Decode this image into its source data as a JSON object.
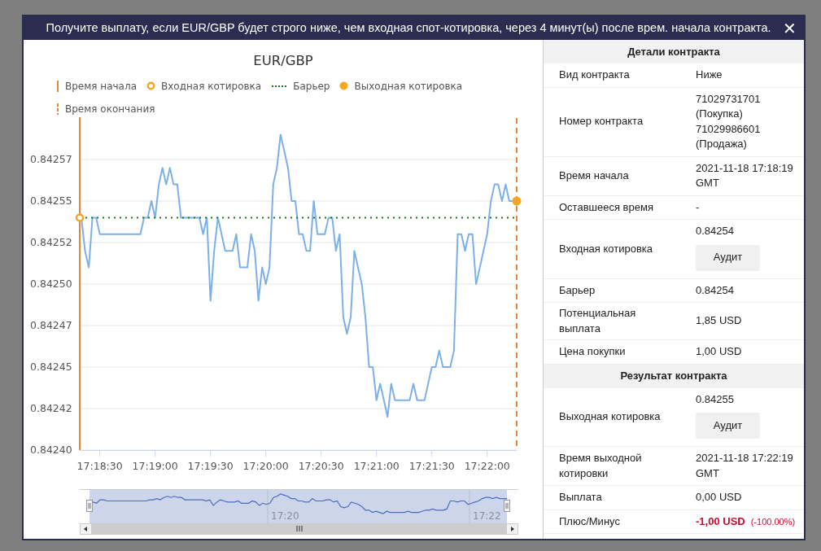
{
  "modal": {
    "title": "Получите выплату, если EUR/GBP будет строго ниже, чем входная спот-котировка, через 4 минут(ы) после врем. начала контракта.",
    "close": "✕"
  },
  "chart": {
    "legend": [
      {
        "kind": "start_line",
        "label": "Время начала"
      },
      {
        "kind": "entry",
        "label": "Входная котировка"
      },
      {
        "kind": "barrier",
        "label": "Барьер"
      },
      {
        "kind": "exit",
        "label": "Выходная котировка"
      },
      {
        "kind": "end_line",
        "label": "Время окончания"
      }
    ],
    "chart_data": {
      "type": "line",
      "title": "EUR/GBP",
      "categories": [
        null,
        null,
        null,
        null,
        null,
        "17:18:30",
        null,
        null,
        null,
        null,
        null,
        null,
        null,
        null,
        null,
        null,
        null,
        null,
        null,
        null,
        "17:19:00",
        null,
        null,
        null,
        null,
        null,
        null,
        null,
        null,
        null,
        null,
        null,
        null,
        null,
        null,
        "17:19:30",
        null,
        null,
        null,
        null,
        null,
        null,
        null,
        null,
        null,
        null,
        null,
        null,
        null,
        null,
        "17:20:00",
        null,
        null,
        null,
        null,
        null,
        null,
        null,
        null,
        null,
        null,
        null,
        null,
        null,
        null,
        "17:20:30",
        null,
        null,
        null,
        null,
        null,
        null,
        null,
        null,
        null,
        null,
        null,
        null,
        null,
        null,
        "17:21:00",
        null,
        null,
        null,
        null,
        null,
        null,
        null,
        null,
        null,
        null,
        null,
        null,
        null,
        null,
        "17:21:30",
        null,
        null,
        null,
        null,
        null,
        null,
        null,
        null,
        null,
        null,
        null,
        null,
        null,
        null,
        "17:22:00",
        null,
        null,
        null,
        null,
        null,
        null,
        null,
        null
      ],
      "series": [
        {
          "color": "#7cb0e8",
          "values": [
            0.84254,
            0.84252,
            0.84251,
            0.84254,
            0.84254,
            0.84253,
            0.84253,
            0.84253,
            0.84253,
            0.84253,
            0.84253,
            0.84253,
            0.84253,
            0.84253,
            0.84253,
            0.84253,
            0.84253,
            0.84254,
            0.84254,
            0.84255,
            0.84254,
            0.84256,
            0.84257,
            0.84256,
            0.84257,
            0.84256,
            0.84256,
            0.84254,
            0.84254,
            0.84254,
            0.84254,
            0.84254,
            0.84254,
            0.84253,
            0.84254,
            0.84249,
            0.84252,
            0.84254,
            0.84253,
            0.84252,
            0.84252,
            0.84252,
            0.84253,
            0.84251,
            0.84251,
            0.84251,
            0.84253,
            0.84252,
            0.84249,
            0.84251,
            0.8425,
            0.84251,
            0.84256,
            0.84257,
            0.84259,
            0.84258,
            0.84257,
            0.84255,
            0.84255,
            0.84253,
            0.84253,
            0.84252,
            0.84252,
            0.84255,
            0.84253,
            0.84253,
            0.84253,
            0.84254,
            0.84254,
            0.84252,
            0.84253,
            0.84248,
            0.84247,
            0.84248,
            0.84252,
            0.84251,
            0.8425,
            0.84248,
            0.84245,
            0.84245,
            0.84243,
            0.84244,
            0.84243,
            0.84242,
            0.84244,
            0.84243,
            0.84243,
            0.84243,
            0.84243,
            0.84243,
            0.84244,
            0.84243,
            0.84243,
            0.84243,
            0.84244,
            0.84245,
            0.84245,
            0.84246,
            0.84245,
            0.84245,
            0.84245,
            0.84246,
            0.84253,
            0.84253,
            0.84252,
            0.84253,
            0.84253,
            0.8425,
            0.84251,
            0.84252,
            0.84253,
            0.84255,
            0.84256,
            0.84256,
            0.84255,
            0.84256,
            0.84255,
            0.84255,
            0.84255
          ]
        }
      ],
      "ylim": [
        0.8424,
        0.8426
      ],
      "grid": true,
      "ref_lines": [
        {
          "axis": "y",
          "value": 0.84254,
          "color": "#1a7a1a"
        }
      ],
      "yticks": [
        {
          "value": 0.8424,
          "label": "0.84240"
        },
        {
          "value": 0.842425,
          "label": "0.84242"
        },
        {
          "value": 0.84245,
          "label": "0.84245"
        },
        {
          "value": 0.842475,
          "label": "0.84247"
        },
        {
          "value": 0.8425,
          "label": "0.84250"
        },
        {
          "value": 0.842525,
          "label": "0.84252"
        },
        {
          "value": 0.84255,
          "label": "0.84255"
        },
        {
          "value": 0.842575,
          "label": "0.84257"
        }
      ]
    },
    "navigator": {
      "labels": [
        "17:20",
        "17:22"
      ]
    }
  },
  "sections": [
    {
      "title": "Детали контракта",
      "rows": [
        {
          "kind": "plain",
          "label": "Вид контракта",
          "value": [
            "Ниже"
          ]
        },
        {
          "kind": "plain",
          "label": "Номер контракта",
          "value": [
            "71029731701",
            "(Покупка)",
            "71029986601",
            "(Продажа)"
          ]
        },
        {
          "kind": "plain",
          "label": "Время начала",
          "value": [
            "2021-11-18 17:18:19",
            "GMT"
          ]
        },
        {
          "kind": "plain",
          "label": "Оставшееся время",
          "value": [
            "-"
          ]
        },
        {
          "kind": "audit",
          "label": "Входная котировка",
          "value": [
            "0.84254"
          ],
          "button": "Аудит"
        },
        {
          "kind": "plain",
          "label": "Барьер",
          "value": [
            "0.84254"
          ]
        },
        {
          "kind": "plain",
          "label": "Потенциальная выплата",
          "value": [
            "1,85 USD"
          ]
        },
        {
          "kind": "plain",
          "label": "Цена покупки",
          "value": [
            "1,00 USD"
          ]
        }
      ]
    },
    {
      "title": "Результат контракта",
      "rows": [
        {
          "kind": "audit",
          "label": "Выходная котировка",
          "value": [
            "0.84255"
          ],
          "button": "Аудит"
        },
        {
          "kind": "plain",
          "label": "Время выходной котировки",
          "value": [
            "2021-11-18 17:22:19",
            "GMT"
          ]
        },
        {
          "kind": "plain",
          "label": "Выплата",
          "value": [
            "0,00 USD"
          ]
        },
        {
          "kind": "loss",
          "label": "Плюс/Минус",
          "value": [
            "-1,00 USD"
          ],
          "note": "(-100.00%)"
        }
      ]
    }
  ]
}
